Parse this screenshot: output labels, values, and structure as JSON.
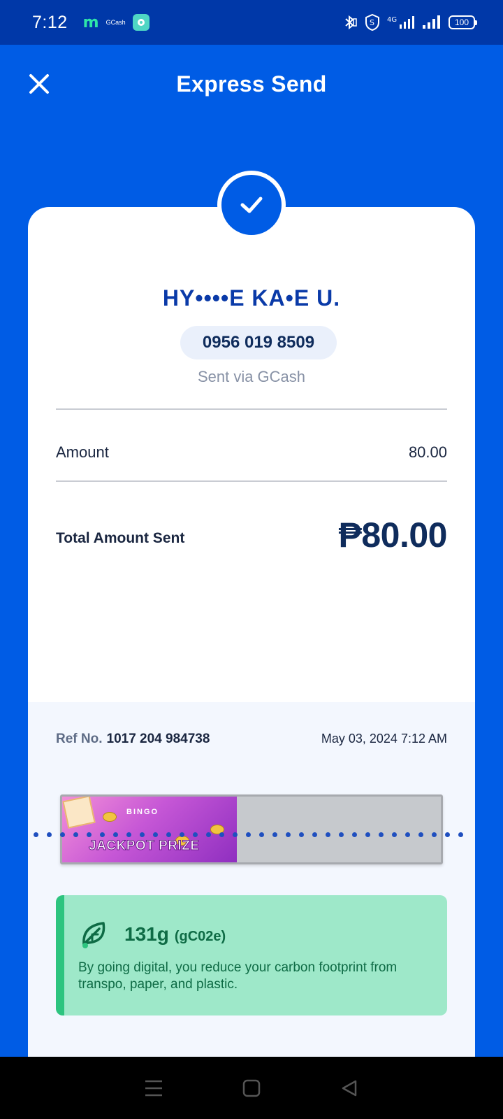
{
  "status_bar": {
    "time": "7:12",
    "gcash_label": "GCash",
    "battery": "100",
    "network": "4G"
  },
  "header": {
    "title": "Express Send"
  },
  "receipt": {
    "recipient_name": "HY••••E KA•E U.",
    "phone": "0956 019 8509",
    "sent_via": "Sent via GCash",
    "amount_label": "Amount",
    "amount_value": "80.00",
    "total_label": "Total Amount Sent",
    "total_value": "₱80.00"
  },
  "reference": {
    "label": "Ref No.",
    "number": "1017 204 984738",
    "datetime": "May 03, 2024 7:12 AM"
  },
  "banner": {
    "brand": "BINGO",
    "headline": "JACKPOT PRIZE"
  },
  "carbon": {
    "value": "131g",
    "unit": "(gC02e)",
    "message": "By going digital, you reduce your carbon footprint from transpo, paper, and plastic."
  },
  "colors": {
    "primary_blue": "#005ce5",
    "status_bar": "#0038a8",
    "carbon_green": "#9ee8c9",
    "carbon_accent": "#2dc47f"
  },
  "icons": {
    "close": "close-icon",
    "check": "check-icon",
    "leaf": "leaf-icon"
  }
}
